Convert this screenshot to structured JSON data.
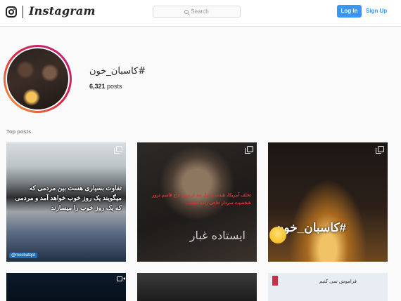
{
  "header": {
    "wordmark": "Instagram",
    "search_placeholder": "Search",
    "login_label": "Log In",
    "signup_label": "Sign Up"
  },
  "profile": {
    "hashtag": "#کاسبان_خون",
    "post_count": "6,321",
    "post_count_suffix": "posts"
  },
  "section": {
    "top_posts_label": "Top posts"
  },
  "posts": [
    {
      "text": "تفاوت بسیاری هست بین مردمی که میگویند یک روز خوب خواهد آمد و مردمی که یک روز خوب را میسازند",
      "handle": "@mosbatqot",
      "icon": "multi-photo-icon"
    },
    {
      "text": "تخلف آمریکا، شدت تحمل بعد از ترور حاج قاسم ترور شخصیت سردار حاجی زاده است...",
      "signature": "ایستاده غبار",
      "icon": "multi-photo-icon"
    },
    {
      "text": "#کاسبان_خون",
      "icon": "multi-photo-icon"
    },
    {
      "icon": "video-icon"
    },
    {},
    {
      "text": "فراموش نمی کنیم"
    }
  ],
  "colors": {
    "accent": "#3897f0",
    "border": "#dbdbdb",
    "background": "#fafafa"
  }
}
